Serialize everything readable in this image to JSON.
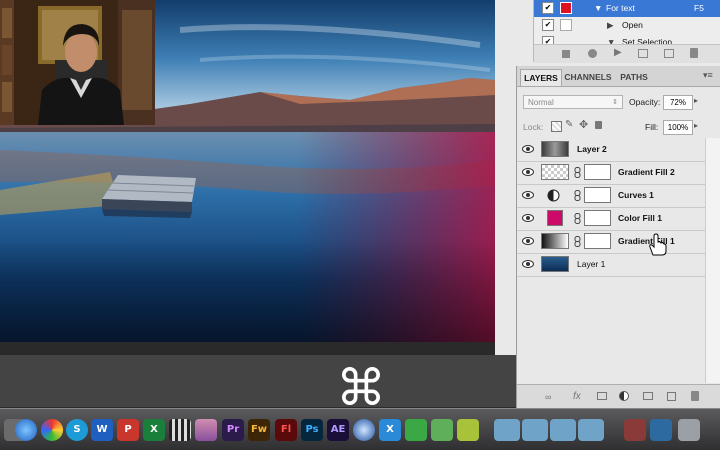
{
  "actions_panel": {
    "rows": [
      {
        "label": "For text",
        "shortcut": "F5"
      },
      {
        "label": "Open"
      },
      {
        "label": "Set Selection"
      }
    ]
  },
  "layers_panel": {
    "tabs": [
      "LAYERS",
      "CHANNELS",
      "PATHS"
    ],
    "blend_mode": "Normal",
    "opacity_label": "Opacity:",
    "opacity_value": "72%",
    "lock_label": "Lock:",
    "fill_label": "Fill:",
    "fill_value": "100%",
    "layers": [
      {
        "name": "Layer 2",
        "thumb": "gray-gradient",
        "has_mask": false
      },
      {
        "name": "Gradient Fill 2",
        "thumb": "checker",
        "has_mask": true
      },
      {
        "name": "Curves 1",
        "thumb": "curves-icon",
        "has_mask": true
      },
      {
        "name": "Color Fill 1",
        "thumb": "magenta-swatch",
        "has_mask": true
      },
      {
        "name": "Gradient Fill 1",
        "thumb": "bw-gradient",
        "has_mask": true
      },
      {
        "name": "Layer 1",
        "thumb": "lake-photo",
        "has_mask": false
      }
    ]
  },
  "overlay": {
    "key_symbol": "⌘"
  },
  "dock": {
    "icons": [
      "Pr",
      "Fw",
      "Fl",
      "Ps",
      "AE"
    ]
  },
  "colors": {
    "color_fill_swatch": "#cc0a68",
    "selection_blue": "#3a78d6",
    "panel_bg": "#e8e8e8",
    "overlay_bar": "#444445"
  }
}
